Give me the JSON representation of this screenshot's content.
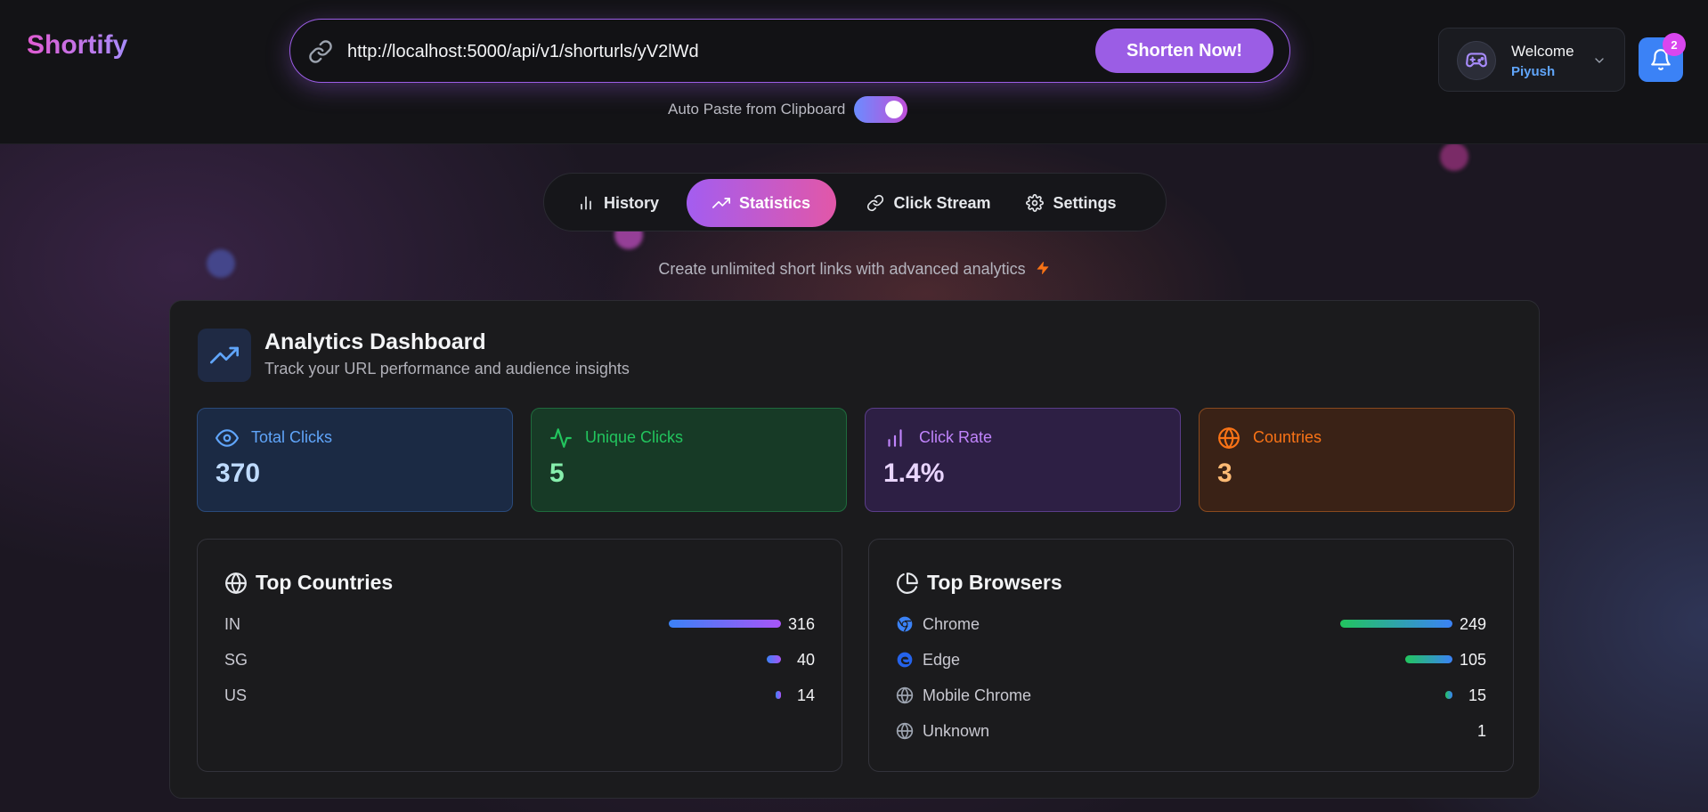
{
  "app": {
    "name": "Shortify"
  },
  "url_bar": {
    "value": "http://localhost:5000/api/v1/shorturls/yV2lWd",
    "button_label": "Shorten Now!"
  },
  "auto_paste": {
    "label": "Auto Paste from Clipboard",
    "enabled": true
  },
  "user": {
    "welcome": "Welcome",
    "name": "Piyush"
  },
  "notifications": {
    "count": "2"
  },
  "tabs": [
    {
      "label": "History",
      "icon": "bar-chart-icon",
      "active": false
    },
    {
      "label": "Statistics",
      "icon": "trending-up-icon",
      "active": true
    },
    {
      "label": "Click Stream",
      "icon": "link-icon",
      "active": false
    },
    {
      "label": "Settings",
      "icon": "gear-icon",
      "active": false
    }
  ],
  "tagline": "Create unlimited short links with advanced analytics",
  "dashboard": {
    "title": "Analytics Dashboard",
    "subtitle": "Track your URL performance and audience insights",
    "stats": [
      {
        "label": "Total Clicks",
        "value": "370",
        "icon": "eye-icon"
      },
      {
        "label": "Unique Clicks",
        "value": "5",
        "icon": "activity-icon"
      },
      {
        "label": "Click Rate",
        "value": "1.4%",
        "icon": "bar-chart-icon"
      },
      {
        "label": "Countries",
        "value": "3",
        "icon": "globe-icon"
      }
    ],
    "top_countries": {
      "title": "Top Countries",
      "rows": [
        {
          "label": "IN",
          "value": "316",
          "count": 316
        },
        {
          "label": "SG",
          "value": "40",
          "count": 40
        },
        {
          "label": "US",
          "value": "14",
          "count": 14
        }
      ]
    },
    "top_browsers": {
      "title": "Top Browsers",
      "rows": [
        {
          "label": "Chrome",
          "value": "249",
          "count": 249,
          "icon": "chrome-icon"
        },
        {
          "label": "Edge",
          "value": "105",
          "count": 105,
          "icon": "edge-icon"
        },
        {
          "label": "Mobile Chrome",
          "value": "15",
          "count": 15,
          "icon": "globe-icon"
        },
        {
          "label": "Unknown",
          "value": "1",
          "count": 1,
          "icon": "globe-icon"
        }
      ]
    }
  },
  "colors": {
    "accent": "#9b5de5",
    "tab_active_from": "#a35df0",
    "tab_active_to": "#e257a8",
    "country_bar_from": "#3b82f6",
    "country_bar_to": "#a855f7",
    "browser_bar_from": "#22c55e",
    "browser_bar_to": "#3b82f6"
  }
}
